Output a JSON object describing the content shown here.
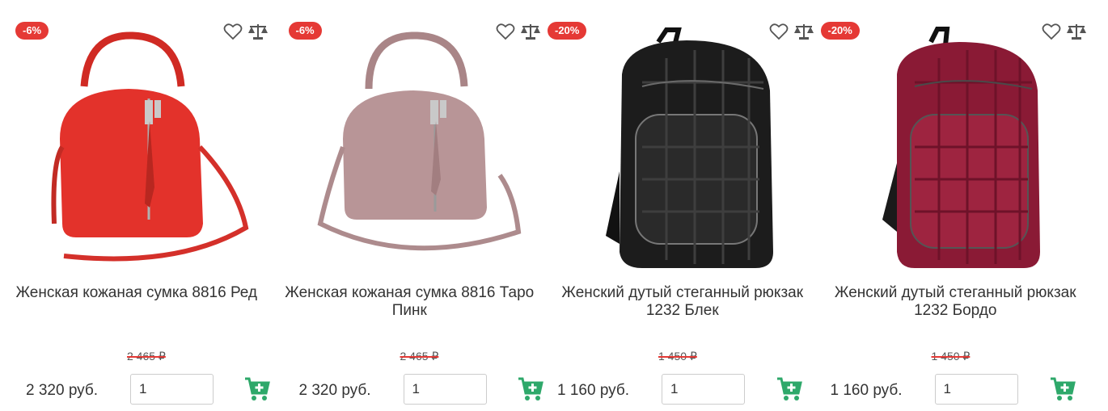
{
  "products": [
    {
      "badge": "-6%",
      "title": "Женская кожаная сумка 8816 Ред",
      "old_price": "2 465 ₽",
      "price": "2 320 руб.",
      "qty": "1",
      "color": "#e3322b",
      "kind": "bag"
    },
    {
      "badge": "-6%",
      "title": "Женская кожаная сумка 8816 Таро Пинк",
      "old_price": "2 465 ₽",
      "price": "2 320 руб.",
      "qty": "1",
      "color": "#b89597",
      "kind": "bag"
    },
    {
      "badge": "-20%",
      "title": "Женский дутый стеганный рюкзак 1232 Блек",
      "old_price": "1 450 ₽",
      "price": "1 160 руб.",
      "qty": "1",
      "color": "#1c1c1c",
      "kind": "backpack"
    },
    {
      "badge": "-20%",
      "title": "Женский дутый стеганный рюкзак 1232 Бордо",
      "old_price": "1 450 ₽",
      "price": "1 160 руб.",
      "qty": "1",
      "color": "#8a1a35",
      "kind": "backpack"
    }
  ],
  "colors": {
    "badge": "#e53935",
    "cart": "#2ea86a",
    "icon": "#555555"
  },
  "icons": {
    "wishlist": "heart-icon",
    "compare": "scales-icon",
    "cart": "add-to-cart-icon"
  }
}
